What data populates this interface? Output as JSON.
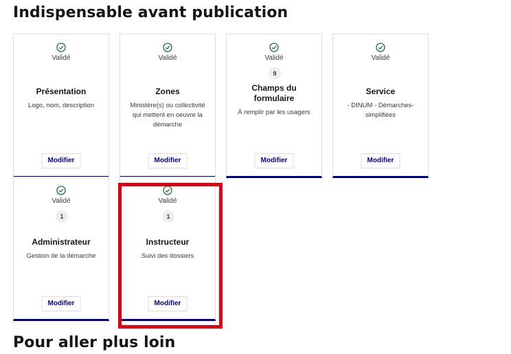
{
  "page": {
    "section_title": "Indispensable avant publication",
    "next_section_title": "Pour aller plus loin"
  },
  "colors": {
    "accent": "#000091",
    "validated": "#18753c",
    "highlight": "#e1000f"
  },
  "cards": [
    {
      "status": "Validé",
      "icon": "check-circle-icon",
      "title": "Présentation",
      "description": "Logo, nom, description",
      "button": "Modifier"
    },
    {
      "status": "Validé",
      "icon": "check-circle-icon",
      "title": "Zones",
      "description": "Ministère(s) ou collectivité qui mettent en oeuvre la démarche",
      "button": "Modifier"
    },
    {
      "status": "Validé",
      "icon": "check-circle-icon",
      "badge": "9",
      "title": "Champs du formulaire",
      "description": "À remplir par les usagers",
      "button": "Modifier"
    },
    {
      "status": "Validé",
      "icon": "check-circle-icon",
      "title": "Service",
      "description": "- DINUM - Démarches-simplifiées",
      "button": "Modifier"
    },
    {
      "status": "Validé",
      "icon": "check-circle-icon",
      "badge": "1",
      "title": "Administrateur",
      "description": "Gestion de la démarche",
      "button": "Modifier"
    },
    {
      "status": "Validé",
      "icon": "check-circle-icon",
      "badge": "1",
      "title": "Instructeur",
      "description": "Suivi des dossiers",
      "button": "Modifier",
      "highlighted": true
    }
  ]
}
